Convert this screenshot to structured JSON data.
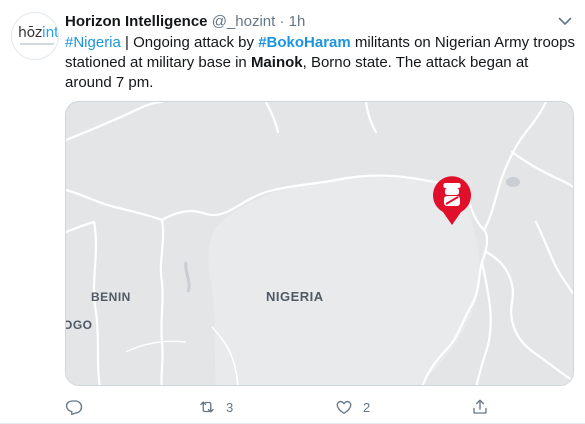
{
  "account": {
    "avatar_logo_prefix": "hōz",
    "avatar_logo_suffix": "int",
    "name": "Horizon Intelligence",
    "handle": "@_hozint",
    "separator": "·",
    "time": "1h"
  },
  "tweet": {
    "segments": [
      {
        "text": "#Nigeria",
        "style": "tag"
      },
      {
        "text": " | Ongoing attack by ",
        "style": "plain"
      },
      {
        "text": "#BokoHaram",
        "style": "tag-bold"
      },
      {
        "text": " militants on Nigerian Army troops stationed at military base in ",
        "style": "plain"
      },
      {
        "text": "Mainok",
        "style": "bold"
      },
      {
        "text": ", Borno state. The attack began at around 7 pm.",
        "style": "plain"
      }
    ]
  },
  "map": {
    "labels": {
      "benin": "BENIN",
      "nigeria": "NIGERIA",
      "togo": "OGO"
    },
    "marker": "military-pin-icon"
  },
  "actions": {
    "reply_count": "",
    "retweet_count": "3",
    "like_count": "2",
    "share_count": ""
  },
  "colors": {
    "link": "#1b95e0",
    "muted": "#657786",
    "map_bg": "#e4e5e7",
    "pin": "#e0102b"
  }
}
